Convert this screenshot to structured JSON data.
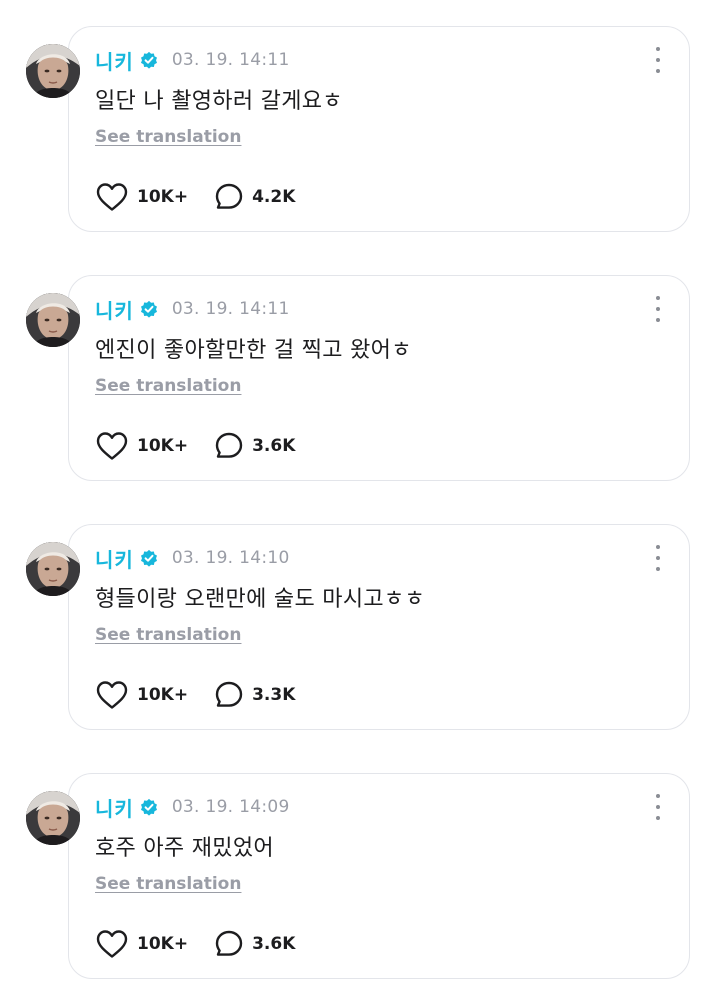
{
  "colors": {
    "author": "#17b7dc",
    "verified_badge": "#17b7dc",
    "timestamp": "#9a9da6",
    "text": "#1d1d1f",
    "card_border": "#e3e5ea"
  },
  "icons": {
    "like": "heart-outline-icon",
    "comment": "speech-bubble-outline-icon",
    "more": "vertical-ellipsis-icon",
    "verified": "verified-check-badge-icon"
  },
  "posts": [
    {
      "author": "니키",
      "timestamp": "03. 19. 14:11",
      "text": "일단 나 촬영하러 갈게요ㅎ",
      "translate_label": "See translation",
      "likes": "10K+",
      "comments": "4.2K"
    },
    {
      "author": "니키",
      "timestamp": "03. 19. 14:11",
      "text": "엔진이 좋아할만한 걸 찍고 왔어ㅎ",
      "translate_label": "See translation",
      "likes": "10K+",
      "comments": "3.6K"
    },
    {
      "author": "니키",
      "timestamp": "03. 19. 14:10",
      "text": "형들이랑 오랜만에 술도 마시고ㅎㅎ",
      "translate_label": "See translation",
      "likes": "10K+",
      "comments": "3.3K"
    },
    {
      "author": "니키",
      "timestamp": "03. 19. 14:09",
      "text": "호주 아주 재밌었어",
      "translate_label": "See translation",
      "likes": "10K+",
      "comments": "3.6K"
    }
  ]
}
